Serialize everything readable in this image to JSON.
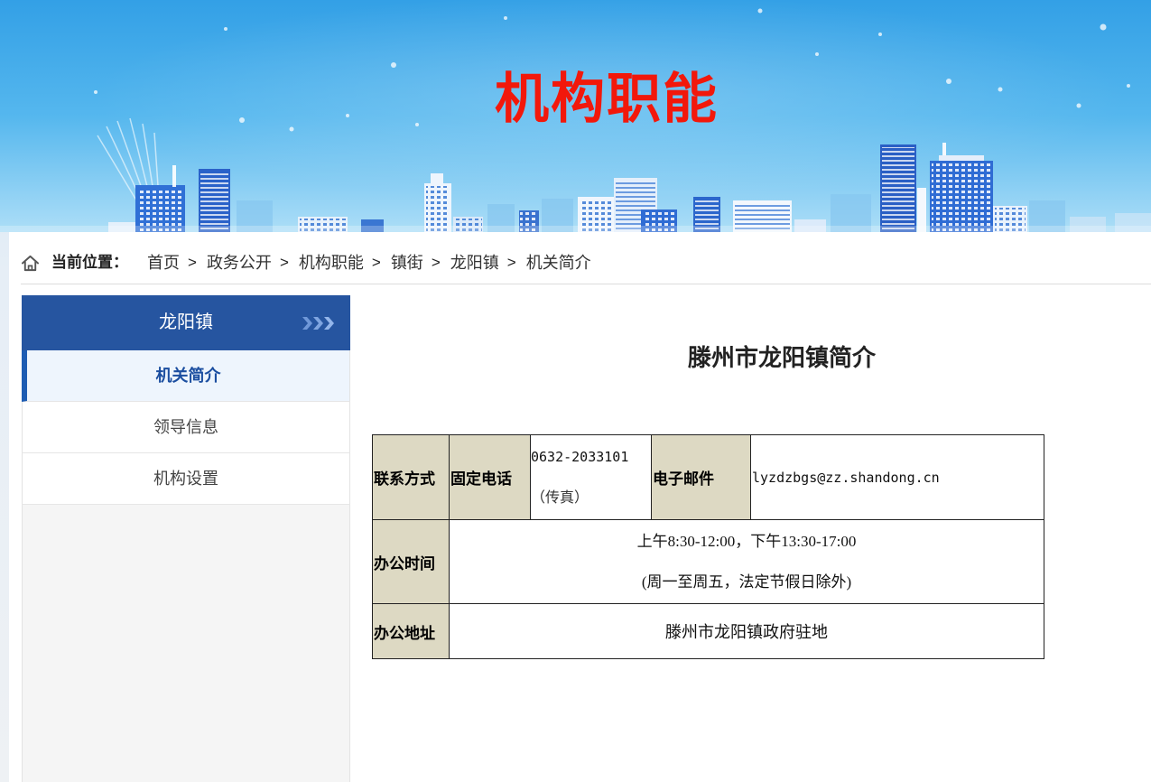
{
  "banner": {
    "title": "机构职能"
  },
  "breadcrumb": {
    "label": "当前位置：",
    "separator": ">",
    "items": [
      "首页",
      "政务公开",
      "机构职能",
      "镇街",
      "龙阳镇",
      "机关简介"
    ]
  },
  "sidebar": {
    "title": "龙阳镇",
    "items": [
      {
        "label": "机关简介",
        "active": true
      },
      {
        "label": "领导信息",
        "active": false
      },
      {
        "label": "机构设置",
        "active": false
      }
    ]
  },
  "main": {
    "title": "滕州市龙阳镇简介",
    "contact_table": {
      "contact_label": "联系方式",
      "phone_label": "固定电话",
      "phone_value": "0632-2033101",
      "phone_note": "（传真）",
      "email_label": "电子邮件",
      "email_value": "lyzdzbgs@zz.shandong.cn",
      "hours_label": "办公时间",
      "hours_value": "上午8:30-12:00，下午13:30-17:00",
      "hours_note": "(周一至周五，法定节假日除外)",
      "address_label": "办公地址",
      "address_value": "滕州市龙阳镇政府驻地"
    }
  },
  "colors": {
    "banner_title": "#f2180b",
    "sidebar_header": "#2655a0",
    "sidebar_active_text": "#1b4ea0",
    "sidebar_active_bar": "#1d5cb3",
    "table_label_bg": "#ddd9c3"
  },
  "icons": {
    "breadcrumb": "home-icon",
    "sidebar_header": "triple-chevron-right-icon"
  }
}
